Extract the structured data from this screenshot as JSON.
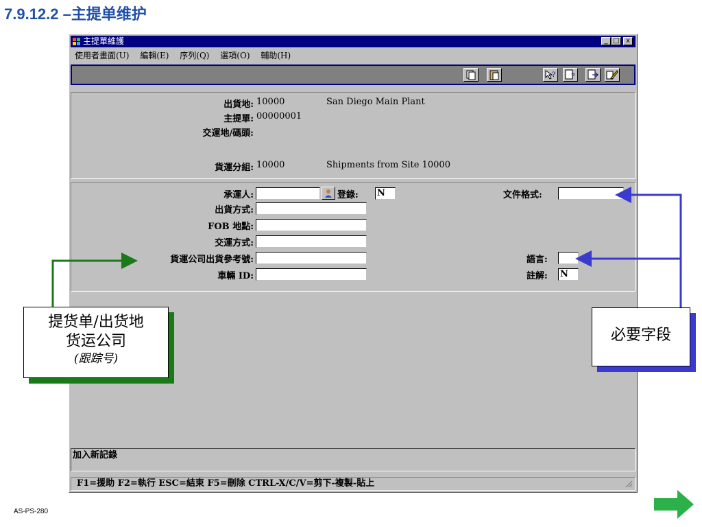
{
  "slide": {
    "title": "7.9.12.2 –主提单维护",
    "code": "AS-PS-280"
  },
  "window": {
    "title": "主提單維護",
    "controls": [
      "_",
      "□",
      "x"
    ],
    "menu": [
      "使用者畫面(U)",
      "編輯(E)",
      "序列(Q)",
      "選項(O)",
      "輔助(H)"
    ]
  },
  "header": {
    "ship_from_label": "出貨地:",
    "ship_from_value": "10000",
    "ship_from_name": "San Diego Main Plant",
    "master_bol_label": "主提單:",
    "master_bol_value": "00000001",
    "ship_to_label": "交運地/碼頭:",
    "shipment_group_label": "貨運分組:",
    "shipment_group_value": "10000",
    "shipment_group_name": "Shipments from Site 10000"
  },
  "form": {
    "carrier_label": "承運人:",
    "carrier_value": "",
    "logged_label": "登錄:",
    "logged_value": "N",
    "doc_format_label": "文件格式:",
    "doc_format_value": "",
    "ship_via_label": "出貨方式:",
    "ship_via_value": "",
    "fob_label": "FOB 地點:",
    "fob_value": "",
    "transport_label": "交運方式:",
    "transport_value": "",
    "carrier_ref_label": "貨運公司出貨參考號:",
    "carrier_ref_value": "",
    "vehicle_label": "車輛 ID:",
    "vehicle_value": "",
    "language_label": "語言:",
    "language_value": "",
    "comments_label": "註解:",
    "comments_value": "N"
  },
  "status": {
    "message": "加入新記錄",
    "keys": "F1=援助 F2=執行 ESC=結束 F5=刪除 CTRL-X/C/V=剪下-複製-貼上"
  },
  "callouts": {
    "left_line1": "提货单/出货地",
    "left_line2": "货运公司",
    "left_line3": "(跟踪号)",
    "right": "必要字段"
  },
  "colors": {
    "title": "#1f4fa8",
    "green": "#1a7a1a",
    "blue": "#3a3acf",
    "window_title": "#000080"
  }
}
